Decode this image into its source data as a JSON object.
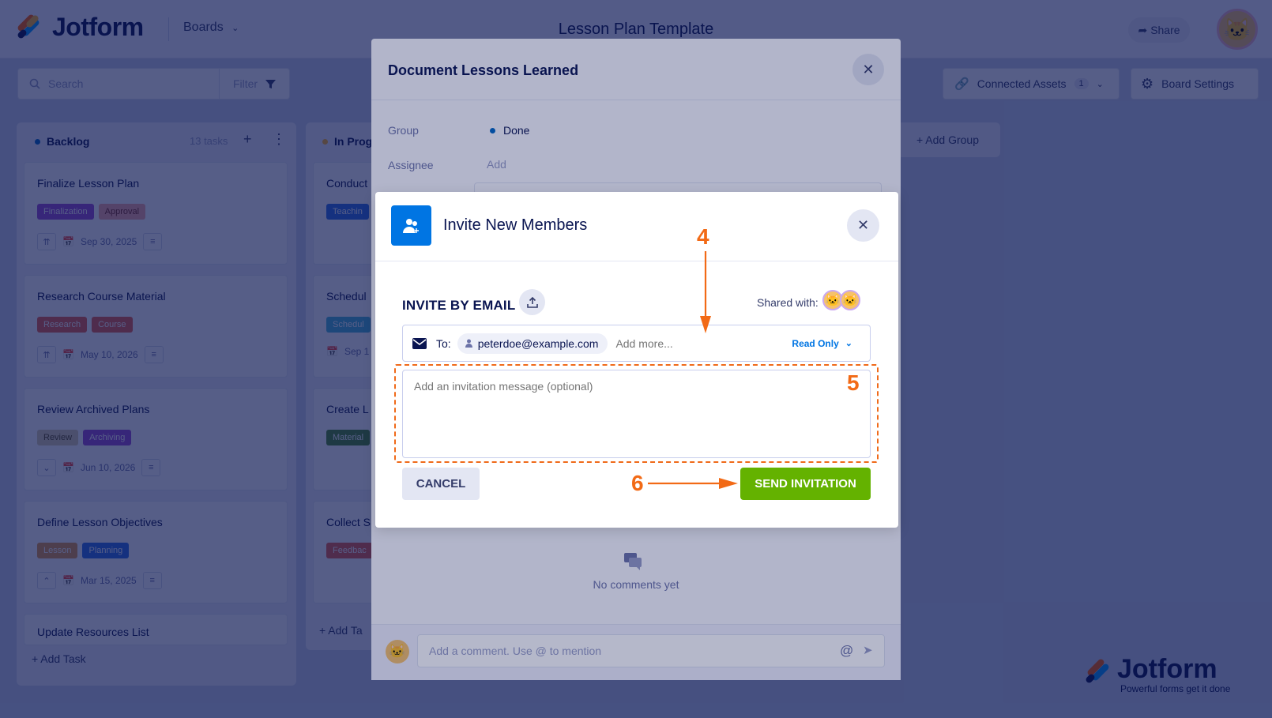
{
  "header": {
    "logo_text": "Jotform",
    "boards_label": "Boards",
    "board_title": "Lesson Plan Template",
    "share_label": "Share"
  },
  "toolbar": {
    "search_placeholder": "Search",
    "filter_label": "Filter",
    "connected_assets_label": "Connected Assets",
    "connected_assets_count": "1",
    "board_settings_label": "Board Settings"
  },
  "columns": [
    {
      "title": "Backlog",
      "count": "13 tasks",
      "add_task": "+ Add Task",
      "cards": [
        {
          "title": "Finalize Lesson Plan",
          "tags": [
            "Finalization",
            "Approval"
          ],
          "date": "Sep 30, 2025"
        },
        {
          "title": "Research Course Material",
          "tags": [
            "Research",
            "Course"
          ],
          "date": "May 10, 2026"
        },
        {
          "title": "Review Archived Plans",
          "tags": [
            "Review",
            "Archiving"
          ],
          "date": "Jun 10, 2026"
        },
        {
          "title": "Define Lesson Objectives",
          "tags": [
            "Lesson",
            "Planning"
          ],
          "date": "Mar 15, 2025"
        },
        {
          "title": "Update Resources List"
        }
      ]
    },
    {
      "title": "In Prog",
      "add_task": "+ Add Ta",
      "cards": [
        {
          "title": "Conduct",
          "tags": [
            "Teachin"
          ]
        },
        {
          "title": "Schedul",
          "tags": [
            "Schedul"
          ],
          "date": "Sep 1"
        },
        {
          "title": "Create L",
          "tags": [
            "Material"
          ]
        },
        {
          "title": "Collect S",
          "tags": [
            "Feedbac"
          ]
        }
      ]
    }
  ],
  "add_group_label": "+ Add Group",
  "document_modal": {
    "title": "Document Lessons Learned",
    "group_label": "Group",
    "group_value": "Done",
    "assignee_label": "Assignee",
    "assignee_value": "Add",
    "no_comments": "No comments yet",
    "comment_placeholder": "Add a comment. Use @ to mention"
  },
  "invite_modal": {
    "title": "Invite New Members",
    "invite_by_email": "INVITE BY EMAIL",
    "shared_with": "Shared with:",
    "to_label": "To:",
    "email_chip": "peterdoe@example.com",
    "add_more_placeholder": "Add more...",
    "permission": "Read Only",
    "message_placeholder": "Add an invitation message (optional)",
    "cancel_label": "CANCEL",
    "send_label": "SEND INVITATION"
  },
  "annotations": {
    "step4": "4",
    "step5": "5",
    "step6": "6"
  },
  "watermark": {
    "brand": "Jotform",
    "tagline": "Powerful forms get it done"
  },
  "colors": {
    "brand_navy": "#0a1551",
    "accent_blue": "#0075e3",
    "send_green": "#64b200",
    "annotation_orange": "#f26a16"
  }
}
